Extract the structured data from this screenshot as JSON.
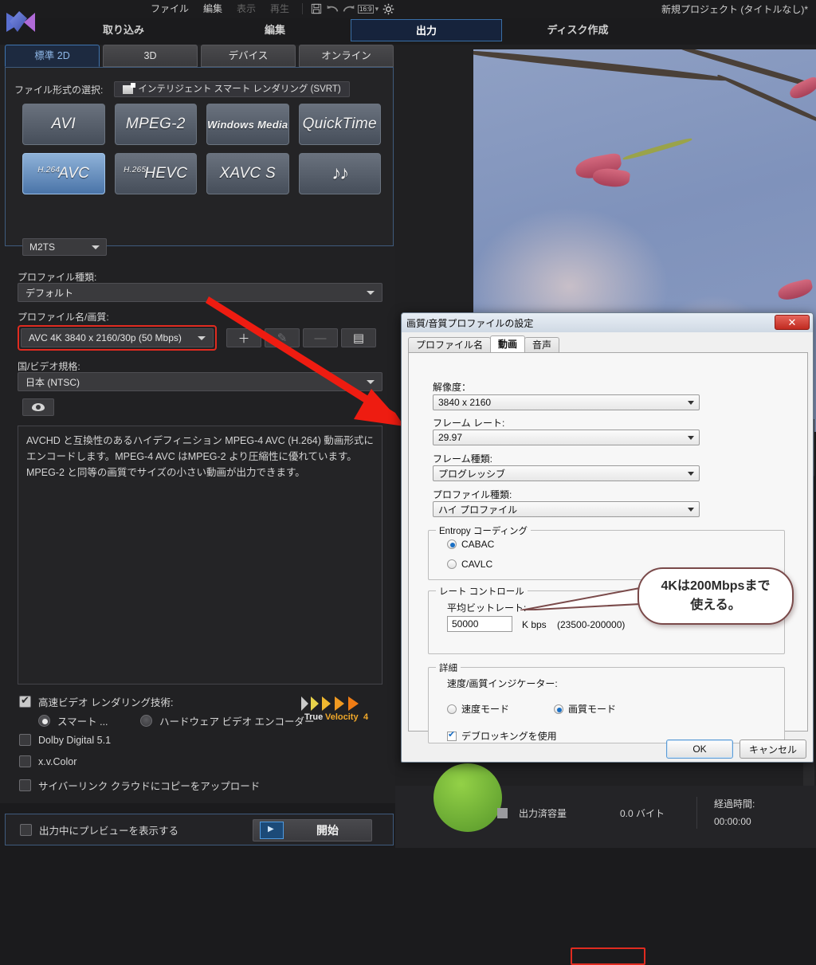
{
  "app": {
    "project_title": "新規プロジェクト (タイトルなし)*",
    "menus": [
      {
        "label": "ファイル",
        "enabled": true
      },
      {
        "label": "編集",
        "enabled": true
      },
      {
        "label": "表示",
        "enabled": false
      },
      {
        "label": "再生",
        "enabled": false
      }
    ],
    "toolbar_icons": [
      "save-icon",
      "undo-icon",
      "redo-icon",
      "aspect-ratio-16-9-icon",
      "settings-gear-icon"
    ],
    "aspect_ratio_label": "16:9"
  },
  "nav_tabs": [
    {
      "label": "取り込み",
      "active": false
    },
    {
      "label": "編集",
      "active": false
    },
    {
      "label": "出力",
      "active": true
    },
    {
      "label": "ディスク作成",
      "active": false
    }
  ],
  "sub_tabs": [
    {
      "label": "標準 2D",
      "active": true
    },
    {
      "label": "3D",
      "active": false
    },
    {
      "label": "デバイス",
      "active": false
    },
    {
      "label": "オンライン",
      "active": false
    }
  ],
  "format": {
    "section_label": "ファイル形式の選択:",
    "svrt_label": "インテリジェント スマート レンダリング (SVRT)",
    "buttons": [
      {
        "label": "AVI",
        "sup": "",
        "selected": false
      },
      {
        "label": "MPEG-2",
        "sup": "",
        "selected": false
      },
      {
        "label": "Windows Media",
        "sup": "",
        "selected": false,
        "small": true
      },
      {
        "label": "QuickTime",
        "sup": "",
        "selected": false
      },
      {
        "label": "AVC",
        "sup": "H.264",
        "selected": true
      },
      {
        "label": "HEVC",
        "sup": "H.265",
        "selected": false
      },
      {
        "label": "XAVC S",
        "sup": "",
        "selected": false
      },
      {
        "label": "♪♪",
        "sup": "",
        "selected": false,
        "notes": true
      }
    ],
    "container_value": "M2TS"
  },
  "profile": {
    "type_label": "プロファイル種類:",
    "type_value": "デフォルト",
    "name_label": "プロファイル名/画質:",
    "name_value": "AVC 4K 3840 x 2160/30p (50 Mbps)",
    "buttons": [
      {
        "name": "add-profile-button",
        "glyph": "＋",
        "enabled": true
      },
      {
        "name": "edit-profile-button",
        "glyph": "✎",
        "enabled": false
      },
      {
        "name": "remove-profile-button",
        "glyph": "—",
        "enabled": false
      },
      {
        "name": "profile-list-button",
        "glyph": "▤",
        "enabled": true
      }
    ],
    "country_label": "国/ビデオ規格:",
    "country_value": "日本 (NTSC)"
  },
  "description": "AVCHD と互換性のあるハイデフィニション MPEG-4 AVC (H.264) 動画形式にエンコードします。MPEG-4 AVC はMPEG-2 より圧縮性に優れています。MPEG-2 と同等の画質でサイズの小さい動画が出力できます。",
  "options": {
    "fast_render": {
      "label": "高速ビデオ レンダリング技術:",
      "checked": true
    },
    "smart": {
      "label": "スマート ...",
      "selected": true
    },
    "hardware": {
      "label": "ハードウェア ビデオ エンコーダー",
      "selected": false
    },
    "dolby": {
      "label": "Dolby Digital 5.1",
      "checked": false
    },
    "xvcolor": {
      "label": "x.v.Color",
      "checked": false
    },
    "cloud": {
      "label": "サイバーリンク クラウドにコピーをアップロード",
      "checked": false
    },
    "preview_while_output": {
      "label": "出力中にプレビューを表示する",
      "checked": false
    },
    "true_velocity": {
      "brand": "True",
      "brand2": "Velocity",
      "version": "4"
    }
  },
  "start_button": {
    "label": "開始"
  },
  "status": {
    "output_size_label": "出力済容量",
    "output_size_value": "0.0  バイト",
    "elapsed_label": "経過時間:",
    "elapsed_value": "00:00:00"
  },
  "dialog": {
    "title": "画質/音質プロファイルの設定",
    "close_glyph": "✕",
    "tabs": [
      {
        "label": "プロファイル名",
        "active": false
      },
      {
        "label": "動画",
        "active": true
      },
      {
        "label": "音声",
        "active": false
      }
    ],
    "resolution": {
      "label": "解像度：",
      "value": "3840 x 2160"
    },
    "framerate": {
      "label": "フレーム レート:",
      "value": "29.97"
    },
    "frametype": {
      "label": "フレーム種類:",
      "value": "プログレッシブ"
    },
    "profiletype": {
      "label": "プロファイル種類:",
      "value": "ハイ プロファイル"
    },
    "entropy": {
      "legend": "Entropy コーディング",
      "options": [
        {
          "label": "CABAC",
          "selected": true
        },
        {
          "label": "CAVLC",
          "selected": false
        }
      ]
    },
    "rate_control": {
      "legend": "レート コントロール",
      "bitrate_label": "平均ビットレート:",
      "bitrate_value": "50000",
      "unit": "K bps",
      "range": "(23500-200000)"
    },
    "advanced": {
      "legend": "詳細",
      "indicator_label": "速度/画質インジケーター:",
      "modes": [
        {
          "label": "速度モード",
          "selected": false
        },
        {
          "label": "画質モード",
          "selected": true
        }
      ],
      "deblocking": {
        "label": "デブロッキングを使用",
        "checked": true
      }
    },
    "ok_label": "OK",
    "cancel_label": "キャンセル"
  },
  "annotation": {
    "callout_line1": "4Kは200Mbpsまで",
    "callout_line2": "使える。",
    "highlight_color": "#ee1c11"
  }
}
